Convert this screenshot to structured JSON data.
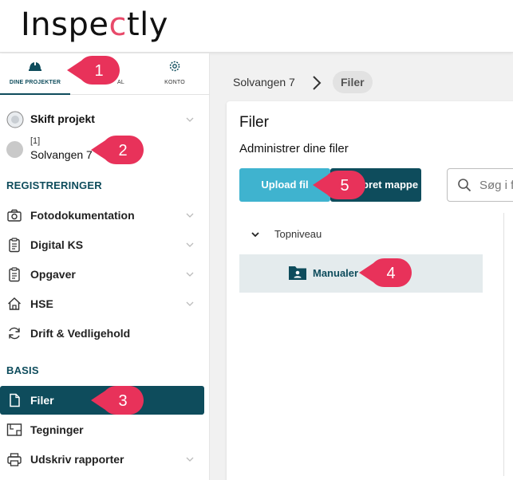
{
  "app": {
    "logo_pre": "Inspe",
    "logo_c": "c",
    "logo_post": "tly"
  },
  "tabs": [
    {
      "label": "DINE PROJEKTER",
      "icon": "hardhat-icon",
      "active": true
    },
    {
      "label": "AL",
      "icon": "",
      "active": false
    },
    {
      "label": "KONTO",
      "icon": "gear-icon",
      "active": false
    }
  ],
  "projects": {
    "parent": {
      "label": "Skift projekt",
      "icon": "globe-icon"
    },
    "current": {
      "number": "[1]",
      "name": "Solvangen 7"
    }
  },
  "sections": {
    "registreringer": "REGISTRERINGER",
    "basis": "BASIS"
  },
  "nav_registreringer": [
    {
      "label": "Fotodokumentation",
      "icon": "camera-icon",
      "chevron": true
    },
    {
      "label": "Digital KS",
      "icon": "clipboard-icon",
      "chevron": true
    },
    {
      "label": "Opgaver",
      "icon": "clipboard-icon",
      "chevron": true
    },
    {
      "label": "HSE",
      "icon": "house-icon",
      "chevron": true
    },
    {
      "label": "Drift & Vedligehold",
      "icon": "refresh-icon",
      "chevron": false
    }
  ],
  "nav_basis": [
    {
      "label": "Filer",
      "icon": "file-icon",
      "active": true
    },
    {
      "label": "Tegninger",
      "icon": "blueprint-icon"
    },
    {
      "label": "Udskriv rapporter",
      "icon": "printer-icon",
      "chevron": true
    }
  ],
  "breadcrumb": {
    "project": "Solvangen 7",
    "current": "Filer"
  },
  "files": {
    "title": "Filer",
    "subtitle": "Administrer dine filer",
    "upload_label": "Upload fil",
    "folder_label": "pret mappe",
    "search_placeholder": "Søg i f",
    "tree_root": "Topniveau",
    "folder": "Manualer"
  },
  "callouts": [
    "1",
    "2",
    "3",
    "4",
    "5"
  ],
  "colors": {
    "primary": "#0e4c5c",
    "accent": "#3fb3cf",
    "callout": "#e8325a"
  }
}
